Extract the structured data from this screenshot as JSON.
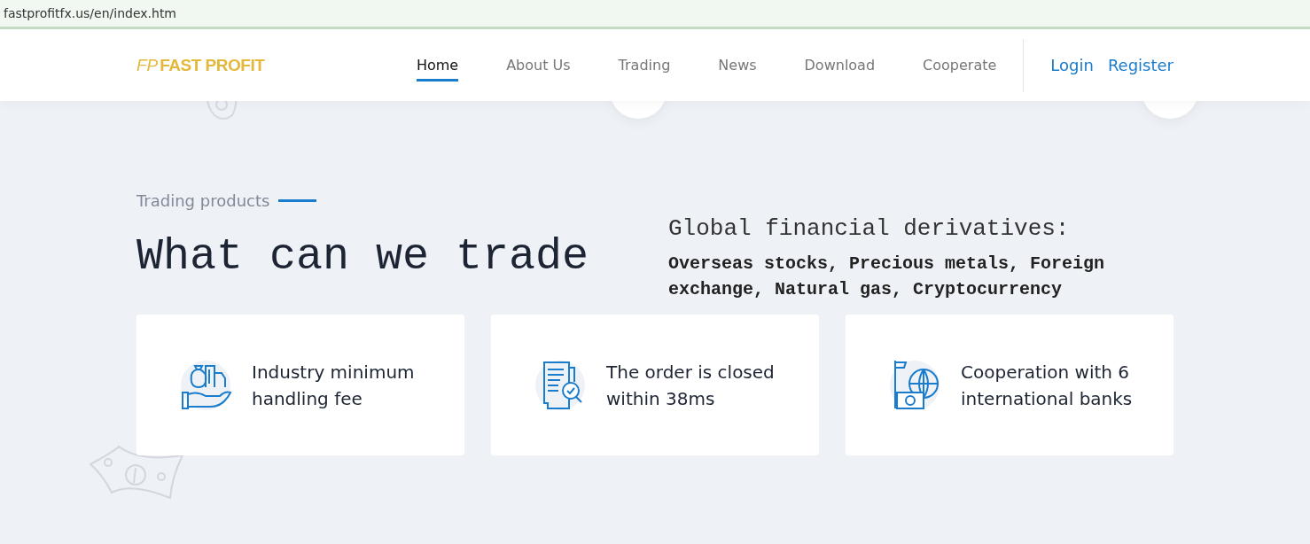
{
  "address_bar": {
    "url": "fastprofitfx.us/en/index.htm"
  },
  "header": {
    "logo_mark": "FP",
    "logo_text": "FAST PROFIT",
    "nav": [
      {
        "label": "Home",
        "selected": true
      },
      {
        "label": "About Us",
        "selected": false
      },
      {
        "label": "Trading",
        "selected": false
      },
      {
        "label": "News",
        "selected": false
      },
      {
        "label": "Download",
        "selected": false
      },
      {
        "label": "Cooperate",
        "selected": false
      }
    ],
    "auth_links": [
      "Login",
      "Register"
    ]
  },
  "section": {
    "eyebrow": "Trading products",
    "title": "What can we trade",
    "subtitle": "Global financial derivatives:",
    "description": "Overseas stocks, Precious metals, Foreign exchange, Natural gas, Cryptocurrency"
  },
  "features": [
    {
      "kind": "money",
      "text": "Industry minimum handling fee"
    },
    {
      "kind": "order",
      "text": "The order is closed within 38ms"
    },
    {
      "kind": "bank",
      "text": "Cooperation with 6 international banks"
    }
  ]
}
